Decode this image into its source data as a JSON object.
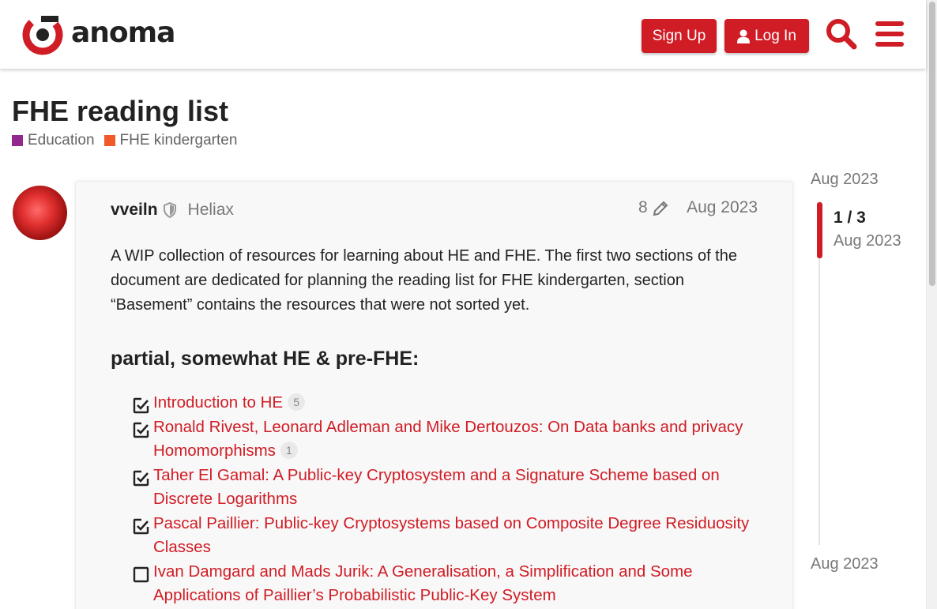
{
  "header": {
    "logo_text": "anoma",
    "signup_label": "Sign Up",
    "login_label": "Log In",
    "accent_color": "#d01c25"
  },
  "topic": {
    "title": "FHE reading list",
    "categories": [
      {
        "label": "Education",
        "color": "#92278f"
      },
      {
        "label": "FHE kindergarten",
        "color": "#f1592a"
      }
    ]
  },
  "post": {
    "username": "vveiln",
    "group": "Heliax",
    "edit_count": "8",
    "date": "Aug 2023",
    "body": "A WIP collection of resources for learning about HE and FHE. The first two sections of the document are dedicated for planning the reading list for FHE kindergarten, section “Basement” contains the resources that were not sorted yet.",
    "section_heading": "partial, somewhat HE & pre-FHE:",
    "items": [
      {
        "text": "Introduction to HE",
        "clicks": "5",
        "checked": true
      },
      {
        "text": "Ronald Rivest, Leonard Adleman and Mike Dertouzos: On Data banks and privacy Homomorphisms",
        "clicks": "1",
        "checked": true
      },
      {
        "text": "Taher El Gamal: A Public-key Cryptosystem and a Signature Scheme based on Discrete Logarithms",
        "clicks": "",
        "checked": true
      },
      {
        "text": "Pascal Paillier: Public-key Cryptosystems based on Composite Degree Residuosity Classes",
        "clicks": "",
        "checked": true
      },
      {
        "text": "Ivan Damgard and Mads Jurik: A Generalisation, a Simplification and Some Applications of Paillier’s Probabilistic Public-Key System",
        "clicks": "",
        "checked": false
      }
    ]
  },
  "timeline": {
    "start_date": "Aug 2023",
    "position": "1 / 3",
    "current_date": "Aug 2023",
    "end_date": "Aug 2023"
  }
}
